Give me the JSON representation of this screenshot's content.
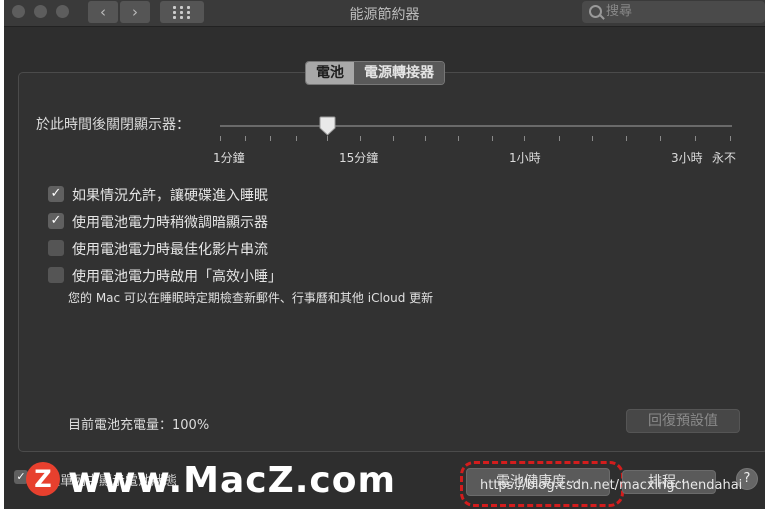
{
  "window": {
    "title": "能源節約器"
  },
  "toolbar": {
    "back_icon": "‹",
    "forward_icon": "›"
  },
  "search": {
    "placeholder": "搜尋"
  },
  "tabs": [
    {
      "label": "電池",
      "active": true
    },
    {
      "label": "電源轉接器",
      "active": false
    }
  ],
  "slider": {
    "label": "於此時間後關閉顯示器：",
    "value_label": "15分鐘",
    "ticks": [
      "1分鐘",
      "15分鐘",
      "1小時",
      "3小時",
      "永不"
    ]
  },
  "options": [
    {
      "label": "如果情況允許，讓硬碟進入睡眠",
      "checked": true
    },
    {
      "label": "使用電池電力時稍微調暗顯示器",
      "checked": true
    },
    {
      "label": "使用電池電力時最佳化影片串流",
      "checked": false
    },
    {
      "label": "使用電池電力時啟用「高效小睡」",
      "checked": false
    }
  ],
  "power_nap_note": "您的 Mac 可以在睡眠時定期檢查新郵件、行事曆和其他 iCloud 更新",
  "battery_charge": "目前電池充電量：100%",
  "restore_defaults": "回復預設值",
  "footer": {
    "show_status": "在選單列中顯示電池狀態",
    "battery_health": "電池健康度⋯",
    "schedule": "排程⋯",
    "help": "?"
  },
  "watermark": {
    "logo_letter": "Z",
    "text": "www.MacZ.com",
    "url": "https://blog.csdn.net/macxingchendahai"
  },
  "colors": {
    "highlight": "#d31d1d",
    "logo": "#e7402e"
  }
}
